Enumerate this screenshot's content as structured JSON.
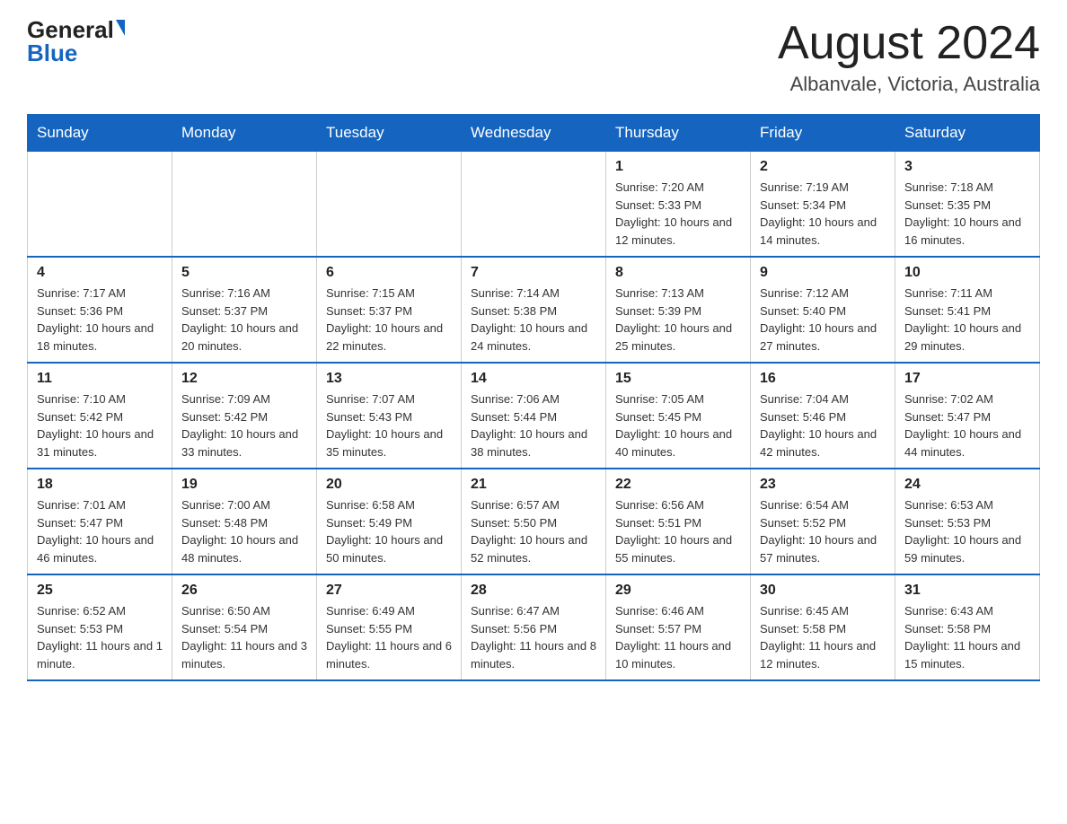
{
  "header": {
    "logo_general": "General",
    "logo_blue": "Blue",
    "title": "August 2024",
    "subtitle": "Albanvale, Victoria, Australia"
  },
  "weekdays": [
    "Sunday",
    "Monday",
    "Tuesday",
    "Wednesday",
    "Thursday",
    "Friday",
    "Saturday"
  ],
  "weeks": [
    [
      {
        "day": "",
        "info": ""
      },
      {
        "day": "",
        "info": ""
      },
      {
        "day": "",
        "info": ""
      },
      {
        "day": "",
        "info": ""
      },
      {
        "day": "1",
        "info": "Sunrise: 7:20 AM\nSunset: 5:33 PM\nDaylight: 10 hours and 12 minutes."
      },
      {
        "day": "2",
        "info": "Sunrise: 7:19 AM\nSunset: 5:34 PM\nDaylight: 10 hours and 14 minutes."
      },
      {
        "day": "3",
        "info": "Sunrise: 7:18 AM\nSunset: 5:35 PM\nDaylight: 10 hours and 16 minutes."
      }
    ],
    [
      {
        "day": "4",
        "info": "Sunrise: 7:17 AM\nSunset: 5:36 PM\nDaylight: 10 hours and 18 minutes."
      },
      {
        "day": "5",
        "info": "Sunrise: 7:16 AM\nSunset: 5:37 PM\nDaylight: 10 hours and 20 minutes."
      },
      {
        "day": "6",
        "info": "Sunrise: 7:15 AM\nSunset: 5:37 PM\nDaylight: 10 hours and 22 minutes."
      },
      {
        "day": "7",
        "info": "Sunrise: 7:14 AM\nSunset: 5:38 PM\nDaylight: 10 hours and 24 minutes."
      },
      {
        "day": "8",
        "info": "Sunrise: 7:13 AM\nSunset: 5:39 PM\nDaylight: 10 hours and 25 minutes."
      },
      {
        "day": "9",
        "info": "Sunrise: 7:12 AM\nSunset: 5:40 PM\nDaylight: 10 hours and 27 minutes."
      },
      {
        "day": "10",
        "info": "Sunrise: 7:11 AM\nSunset: 5:41 PM\nDaylight: 10 hours and 29 minutes."
      }
    ],
    [
      {
        "day": "11",
        "info": "Sunrise: 7:10 AM\nSunset: 5:42 PM\nDaylight: 10 hours and 31 minutes."
      },
      {
        "day": "12",
        "info": "Sunrise: 7:09 AM\nSunset: 5:42 PM\nDaylight: 10 hours and 33 minutes."
      },
      {
        "day": "13",
        "info": "Sunrise: 7:07 AM\nSunset: 5:43 PM\nDaylight: 10 hours and 35 minutes."
      },
      {
        "day": "14",
        "info": "Sunrise: 7:06 AM\nSunset: 5:44 PM\nDaylight: 10 hours and 38 minutes."
      },
      {
        "day": "15",
        "info": "Sunrise: 7:05 AM\nSunset: 5:45 PM\nDaylight: 10 hours and 40 minutes."
      },
      {
        "day": "16",
        "info": "Sunrise: 7:04 AM\nSunset: 5:46 PM\nDaylight: 10 hours and 42 minutes."
      },
      {
        "day": "17",
        "info": "Sunrise: 7:02 AM\nSunset: 5:47 PM\nDaylight: 10 hours and 44 minutes."
      }
    ],
    [
      {
        "day": "18",
        "info": "Sunrise: 7:01 AM\nSunset: 5:47 PM\nDaylight: 10 hours and 46 minutes."
      },
      {
        "day": "19",
        "info": "Sunrise: 7:00 AM\nSunset: 5:48 PM\nDaylight: 10 hours and 48 minutes."
      },
      {
        "day": "20",
        "info": "Sunrise: 6:58 AM\nSunset: 5:49 PM\nDaylight: 10 hours and 50 minutes."
      },
      {
        "day": "21",
        "info": "Sunrise: 6:57 AM\nSunset: 5:50 PM\nDaylight: 10 hours and 52 minutes."
      },
      {
        "day": "22",
        "info": "Sunrise: 6:56 AM\nSunset: 5:51 PM\nDaylight: 10 hours and 55 minutes."
      },
      {
        "day": "23",
        "info": "Sunrise: 6:54 AM\nSunset: 5:52 PM\nDaylight: 10 hours and 57 minutes."
      },
      {
        "day": "24",
        "info": "Sunrise: 6:53 AM\nSunset: 5:53 PM\nDaylight: 10 hours and 59 minutes."
      }
    ],
    [
      {
        "day": "25",
        "info": "Sunrise: 6:52 AM\nSunset: 5:53 PM\nDaylight: 11 hours and 1 minute."
      },
      {
        "day": "26",
        "info": "Sunrise: 6:50 AM\nSunset: 5:54 PM\nDaylight: 11 hours and 3 minutes."
      },
      {
        "day": "27",
        "info": "Sunrise: 6:49 AM\nSunset: 5:55 PM\nDaylight: 11 hours and 6 minutes."
      },
      {
        "day": "28",
        "info": "Sunrise: 6:47 AM\nSunset: 5:56 PM\nDaylight: 11 hours and 8 minutes."
      },
      {
        "day": "29",
        "info": "Sunrise: 6:46 AM\nSunset: 5:57 PM\nDaylight: 11 hours and 10 minutes."
      },
      {
        "day": "30",
        "info": "Sunrise: 6:45 AM\nSunset: 5:58 PM\nDaylight: 11 hours and 12 minutes."
      },
      {
        "day": "31",
        "info": "Sunrise: 6:43 AM\nSunset: 5:58 PM\nDaylight: 11 hours and 15 minutes."
      }
    ]
  ]
}
